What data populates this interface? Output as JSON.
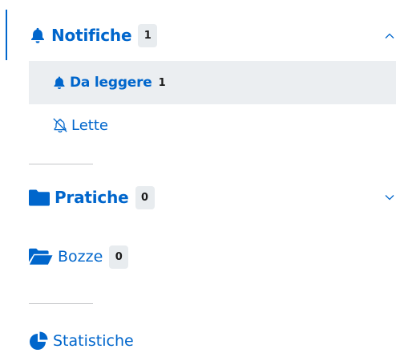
{
  "sidebar": {
    "notifiche": {
      "label": "Notifiche",
      "count": "1",
      "icon": "bell-icon",
      "items": [
        {
          "label": "Da leggere",
          "count": "1",
          "icon": "bell-icon"
        },
        {
          "label": "Lette",
          "icon": "bell-slash-icon"
        }
      ]
    },
    "pratiche": {
      "label": "Pratiche",
      "count": "0",
      "icon": "folder-icon"
    },
    "bozze": {
      "label": "Bozze",
      "count": "0",
      "icon": "folder-open-icon"
    },
    "statistiche": {
      "label": "Statistiche",
      "icon": "pie-chart-icon"
    }
  },
  "colors": {
    "primary": "#0066cc",
    "active_bg": "#ebeef1",
    "badge_bg": "#e8ecef",
    "divider": "#c5c7c9"
  }
}
